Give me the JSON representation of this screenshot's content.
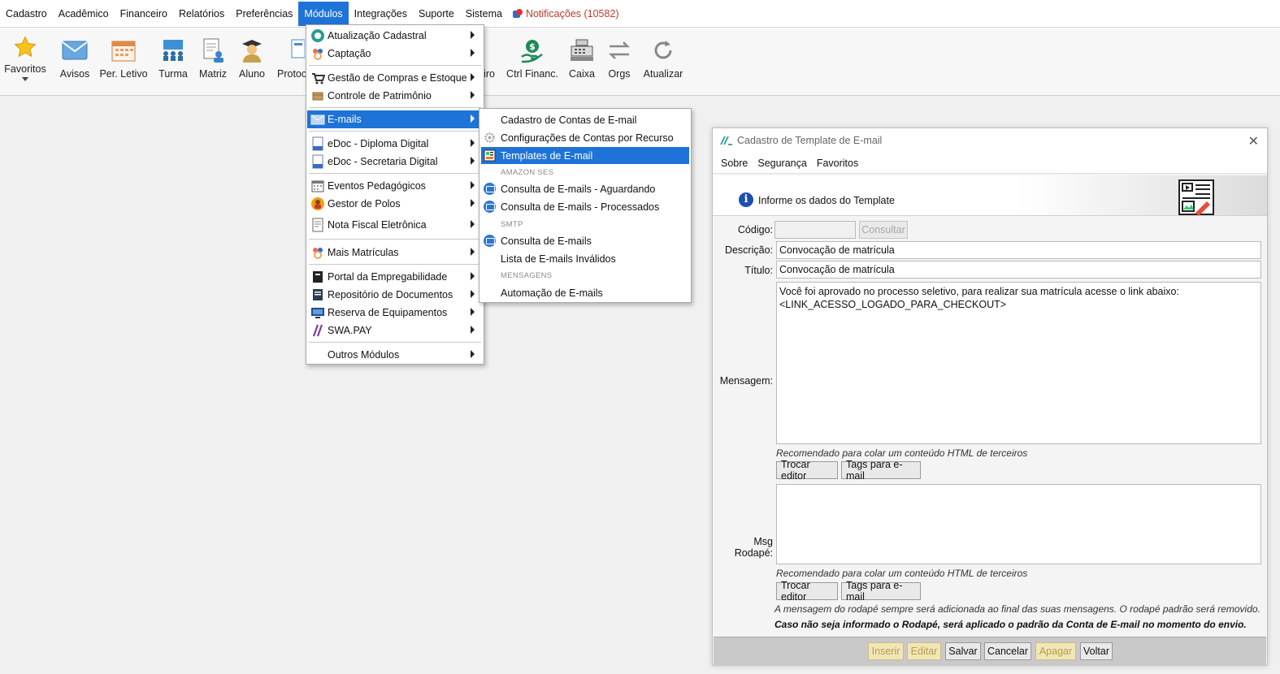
{
  "menubar": {
    "items": [
      "Cadastro",
      "Acadêmico",
      "Financeiro",
      "Relatórios",
      "Preferências",
      "Módulos",
      "Integrações",
      "Suporte",
      "Sistema"
    ],
    "notifications": "Notificações (10582)",
    "accent": "#1e73d8"
  },
  "toolbar": {
    "favoritos": "Favoritos",
    "avisos": "Avisos",
    "per_letivo": "Per. Letivo",
    "turma": "Turma",
    "matriz": "Matriz",
    "aluno": "Aluno",
    "protoc": "Protoc",
    "iro": "iro",
    "ctrl_financ": "Ctrl Financ.",
    "caixa": "Caixa",
    "orgs": "Orgs",
    "atualizar": "Atualizar"
  },
  "modulos_menu": {
    "atualizacao_cadastral": "Atualização Cadastral",
    "captacao": "Captação",
    "gestao_compras": "Gestão de Compras e Estoque",
    "controle_patrimonio": "Controle de Patrimônio",
    "emails": "E-mails",
    "edoc_diploma": "eDoc - Diploma Digital",
    "edoc_secretaria": "eDoc - Secretaria Digital",
    "eventos_pedagogicos": "Eventos Pedagógicos",
    "gestor_polos": "Gestor de Polos",
    "nota_fiscal": "Nota Fiscal Eletrônica",
    "mais_matriculas": "Mais Matrículas",
    "portal_empregabilidade": "Portal da Empregabilidade",
    "repositorio_documentos": "Repositório de Documentos",
    "reserva_equipamentos": "Reserva de Equipamentos",
    "swa_pay": "SWA.PAY",
    "outros_modulos": "Outros Módulos"
  },
  "emails_submenu": {
    "cadastro_contas": "Cadastro de Contas de E-mail",
    "configuracoes_contas": "Configurações de Contas por Recurso",
    "templates": "Templates de E-mail",
    "header_amazon": "AMAZON SES",
    "consulta_aguardando": "Consulta de E-mails - Aguardando",
    "consulta_processados": "Consulta de E-mails - Processados",
    "header_smtp": "SMTP",
    "consulta_emails": "Consulta de E-mails",
    "lista_invalidos": "Lista de E-mails Inválidos",
    "header_mensagens": "MENSAGENS",
    "automacao": "Automação de E-mails"
  },
  "window": {
    "title": "Cadastro de Template de E-mail",
    "close": "✕",
    "menu": [
      "Sobre",
      "Segurança",
      "Favoritos"
    ],
    "info": "Informe os dados do Template",
    "labels": {
      "codigo": "Código:",
      "descricao": "Descrição:",
      "titulo": "Título:",
      "mensagem": "Mensagem:",
      "msg_rodape": "Msg Rodapé:"
    },
    "codigo_value": "",
    "consultar": "Consultar",
    "descricao_value": "Convocação de matrícula",
    "titulo_value": "Convocação de matrícula",
    "mensagem_value": "Você foi aprovado no processo seletivo, para realizar sua matrícula acesse o link abaixo:\n<LINK_ACESSO_LOGADO_PARA_CHECKOUT>",
    "rodape_value": "",
    "hint": "Recomendado para colar um conteúdo HTML de terceiros",
    "trocar_editor": "Trocar editor",
    "tags_email": "Tags para e-mail",
    "note1": "A mensagem do rodapé sempre será adicionada ao final das suas mensagens. O rodapé padrão será removido.",
    "note2": "Caso não seja informado o Rodapé, será aplicado o padrão da Conta de E-mail no momento do envio.",
    "buttons": {
      "inserir": "Inserir",
      "editar": "Editar",
      "salvar": "Salvar",
      "cancelar": "Cancelar",
      "apagar": "Apagar",
      "voltar": "Voltar"
    }
  }
}
